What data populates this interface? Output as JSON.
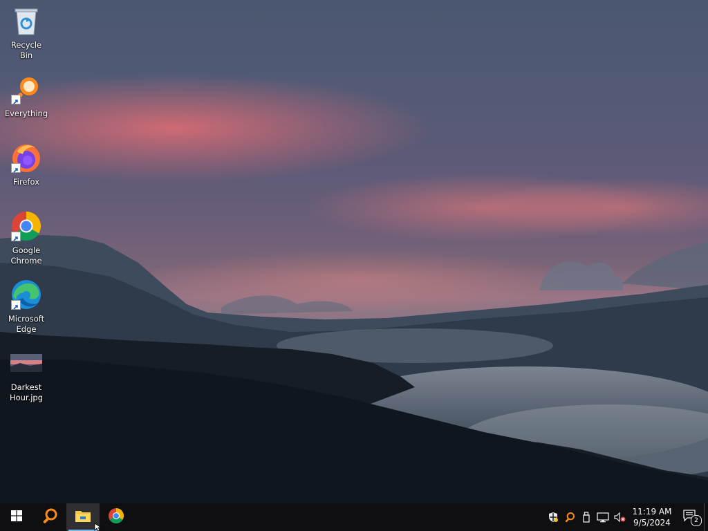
{
  "desktop": {
    "icons": [
      {
        "label": "Recycle Bin",
        "icon": "recycle-bin-icon"
      },
      {
        "label": "Everything",
        "icon": "everything-search-icon"
      },
      {
        "label": "Firefox",
        "icon": "firefox-icon"
      },
      {
        "label": "Google\nChrome",
        "icon": "chrome-icon"
      },
      {
        "label": "Microsoft\nEdge",
        "icon": "edge-icon"
      },
      {
        "label": "Darkest\nHour.jpg",
        "icon": "image-file-icon"
      }
    ]
  },
  "taskbar": {
    "buttons": [
      "start-icon",
      "everything-search-icon",
      "file-explorer-icon",
      "chrome-icon"
    ],
    "active": "file-explorer-icon",
    "tray_icons": [
      "security-icon",
      "everything-search-icon",
      "usb-icon",
      "network-icon",
      "volume-muted-icon"
    ],
    "clock": {
      "time": "11:19 AM",
      "date": "9/5/2024"
    },
    "notifications": {
      "count": "2",
      "icon": "action-center-icon"
    }
  },
  "colors": {
    "taskbar_bg": "#0f0f12",
    "active_indicator": "#76b9ed",
    "accent": "#ec6e73"
  }
}
